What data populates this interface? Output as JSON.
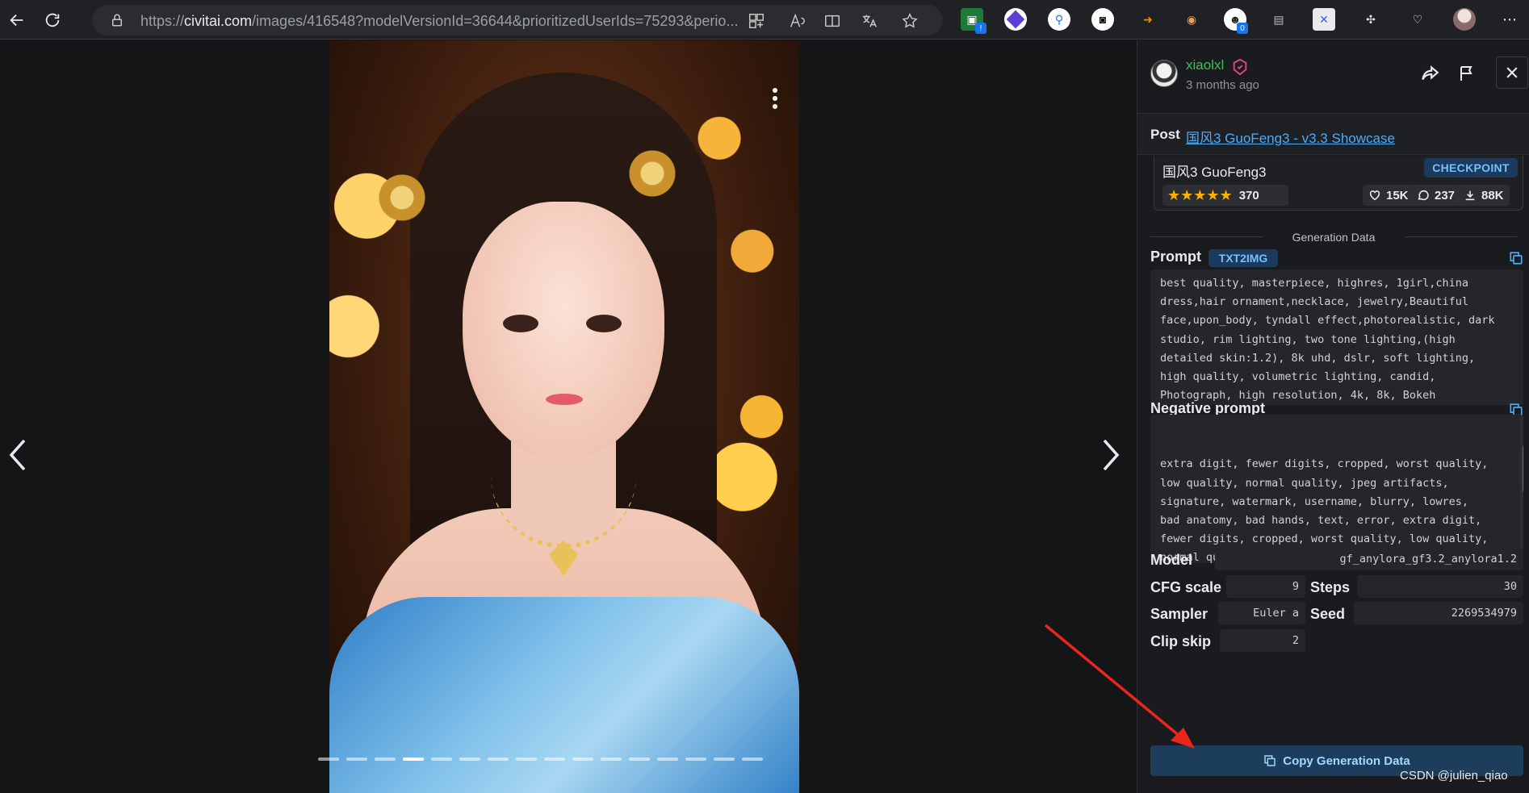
{
  "browser": {
    "url_prefix": "https://",
    "url_domain": "civitai.com",
    "url_rest": "/images/416548?modelVersionId=36644&prioritizedUserIds=75293&perio...",
    "ext_badge_count": "0",
    "ext_badge_alert": "!"
  },
  "viewer": {
    "slide_count": 16,
    "active_slide": 4
  },
  "post": {
    "username": "xiaolxl",
    "time_ago": "3 months ago",
    "post_label": "Post",
    "post_link": "国风3 GuoFeng3 - v3.3 Showcase"
  },
  "model": {
    "name": "国风3 GuoFeng3",
    "type_badge": "CHECKPOINT",
    "rating_count": "370",
    "rating_stars": 5,
    "likes": "15K",
    "comments": "237",
    "downloads": "88K"
  },
  "generation": {
    "section_title": "Generation Data",
    "prompt_label": "Prompt",
    "prompt_type": "TXT2IMG",
    "prompt": "best quality, masterpiece, highres, 1girl,china\ndress,hair ornament,necklace, jewelry,Beautiful\nface,upon_body, tyndall effect,photorealistic, dark\nstudio, rim lighting, two tone lighting,(high\ndetailed skin:1.2), 8k uhd, dslr, soft lighting,\nhigh quality, volumetric lighting, candid,\nPhotograph, high resolution, 4k, 8k, Bokeh",
    "negative_label": "Negative prompt",
    "negative_prompt": "extra digit, fewer digits, cropped, worst quality,\nlow quality, normal quality, jpeg artifacts,\nsignature, watermark, username, blurry, lowres,\nbad anatomy, bad hands, text, error, extra digit,\nfewer digits, cropped, worst quality, low quality,\nnormal quality, jpeg artifacts, signature,\nwatermark, username, blurry,\nugly,pregnant,vore,duplicate,morbid,mut",
    "model_label": "Model",
    "model_value": "gf_anylora_gf3.2_anylora1.2",
    "cfg_label": "CFG scale",
    "cfg_value": "9",
    "steps_label": "Steps",
    "steps_value": "30",
    "sampler_label": "Sampler",
    "sampler_value": "Euler a",
    "seed_label": "Seed",
    "seed_value": "2269534979",
    "clip_label": "Clip skip",
    "clip_value": "2",
    "copy_button": "Copy Generation Data"
  },
  "watermark": "CSDN @julien_qiao",
  "colors": {
    "username": "#40c057",
    "accent": "#4dabf7",
    "badge_bg": "#1c3a5c",
    "panel_bg": "#1a1b1e",
    "annotation_arrow": "#e8261c"
  }
}
